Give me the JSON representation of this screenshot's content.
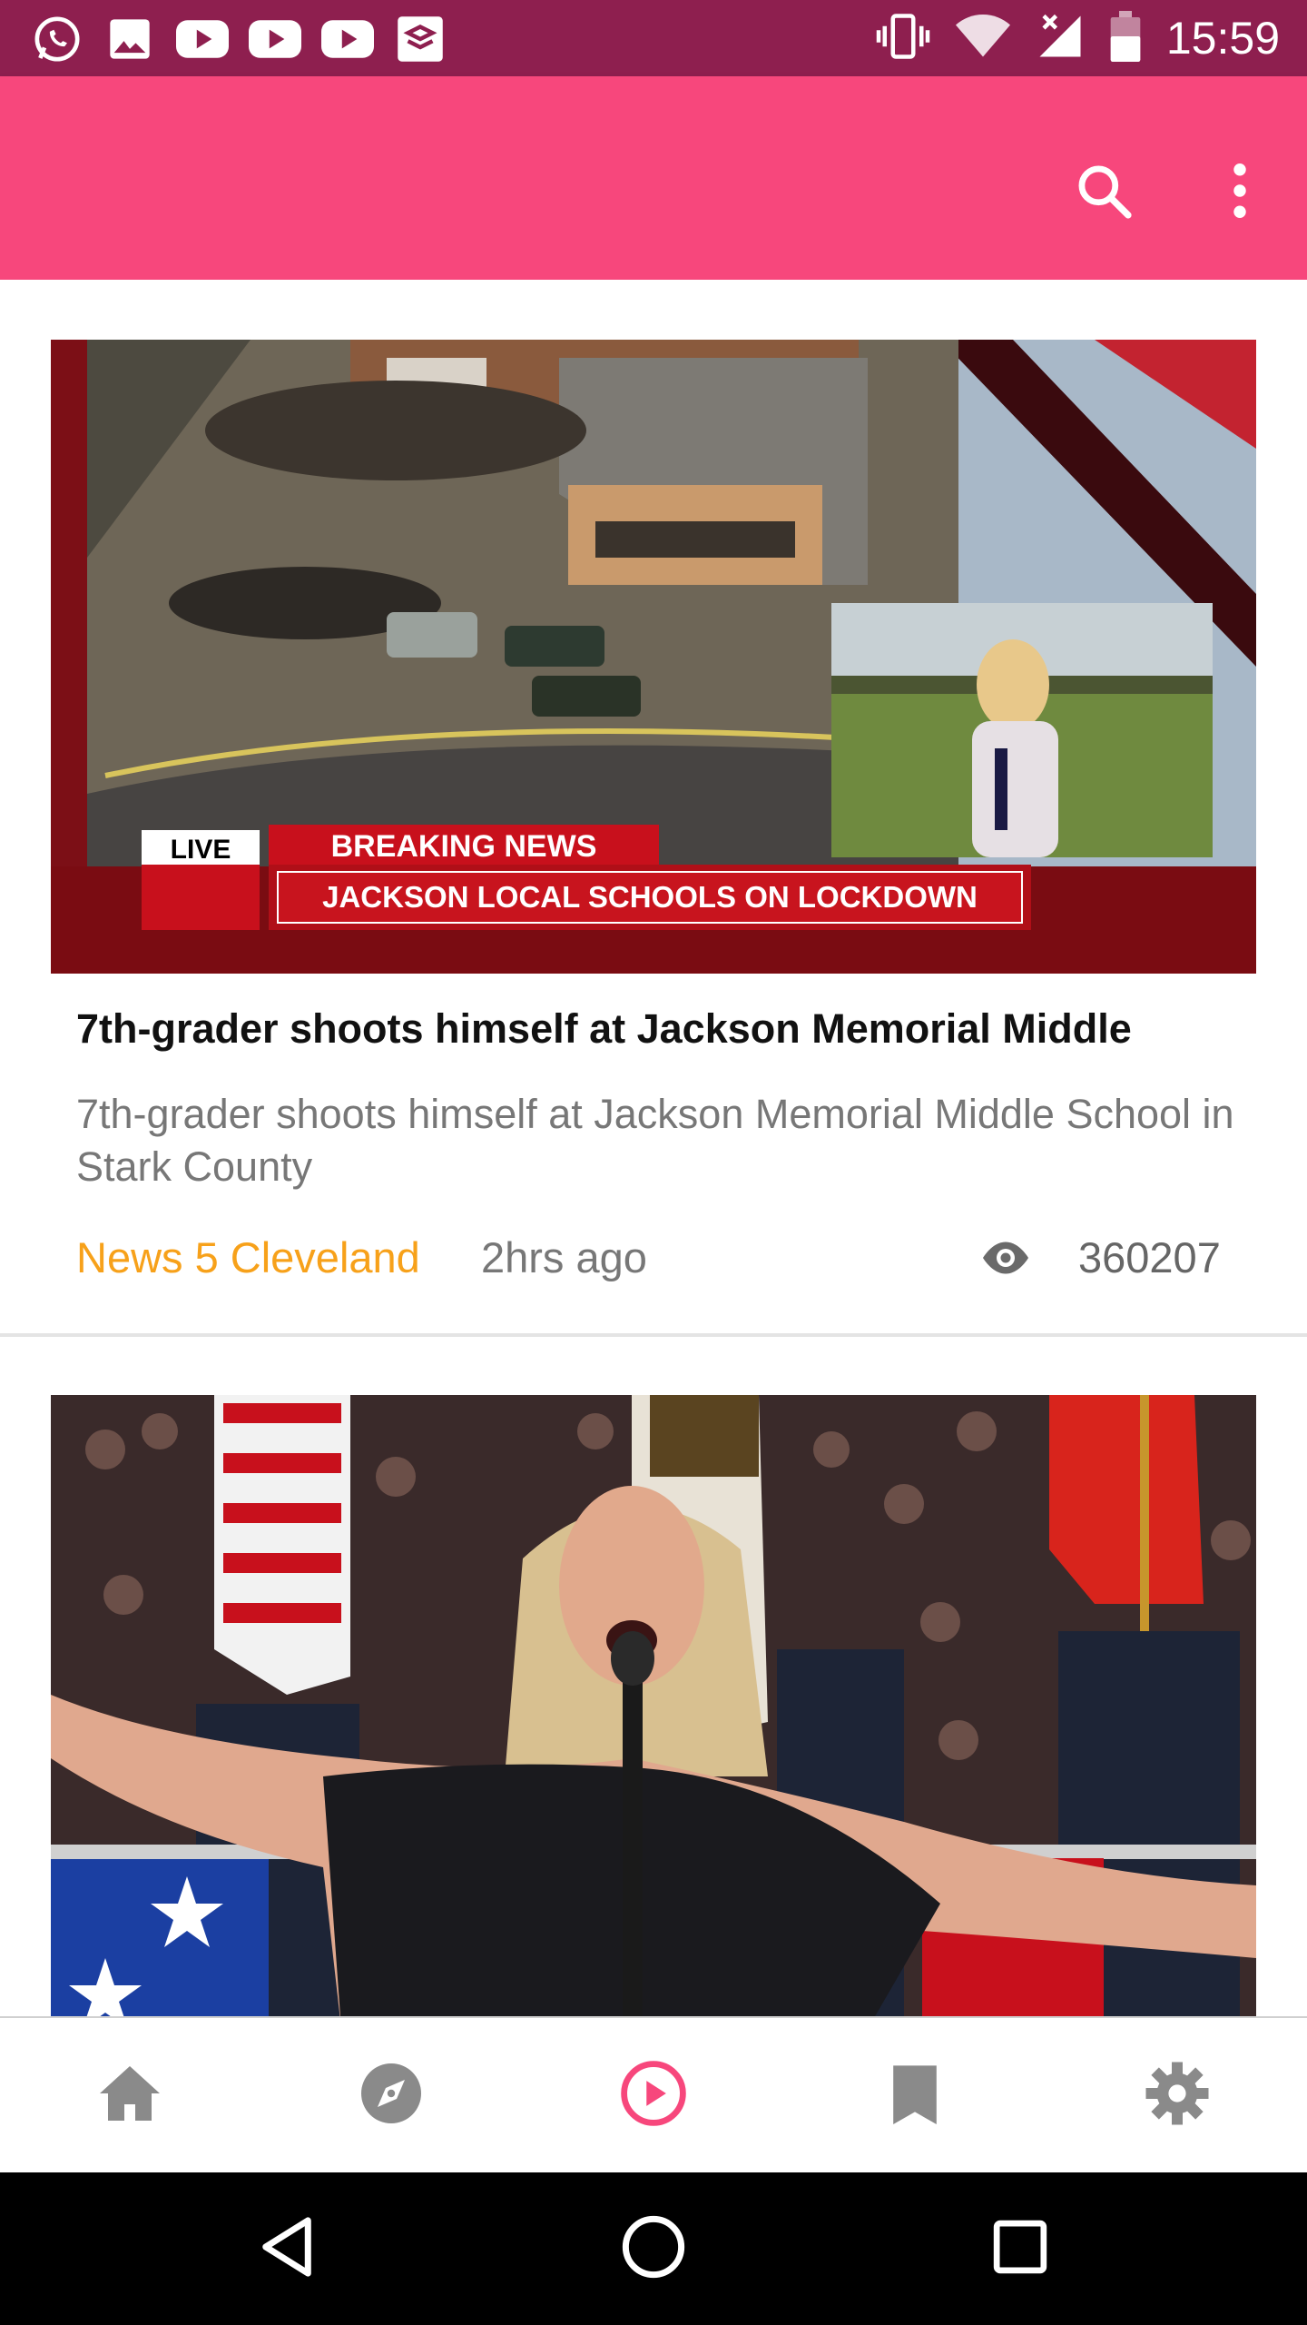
{
  "status_bar": {
    "time": "15:59",
    "left_icons": [
      "whatsapp-icon",
      "gallery-icon",
      "youtube-icon",
      "youtube-icon",
      "youtube-icon",
      "app-icon"
    ],
    "right_icons": [
      "vibrate-icon",
      "wifi-icon",
      "signal-icon",
      "battery-icon"
    ]
  },
  "app_bar": {
    "color": "#f7477c",
    "actions": [
      "search-icon",
      "more-vert-icon"
    ]
  },
  "feed": [
    {
      "image_text": {
        "live": "LIVE",
        "breaking": "BREAKING NEWS",
        "ticker": "JACKSON LOCAL SCHOOLS ON LOCKDOWN"
      },
      "title": "7th-grader shoots himself at Jackson Memorial Middle",
      "description": "7th-grader shoots himself at Jackson Memorial Middle School in Stark County",
      "source": "News 5 Cleveland",
      "time": "2hrs ago",
      "views": "360207"
    },
    {
      "image_alt": "singer performing national anthem"
    }
  ],
  "bottom_nav": {
    "items": [
      "home-icon",
      "explore-icon",
      "play-icon",
      "bookmark-icon",
      "settings-icon"
    ],
    "active_index": 2,
    "active_color": "#f7477c",
    "inactive_color": "#8a8a8a"
  },
  "system_nav": [
    "back-icon",
    "home-circle-icon",
    "recents-icon"
  ]
}
